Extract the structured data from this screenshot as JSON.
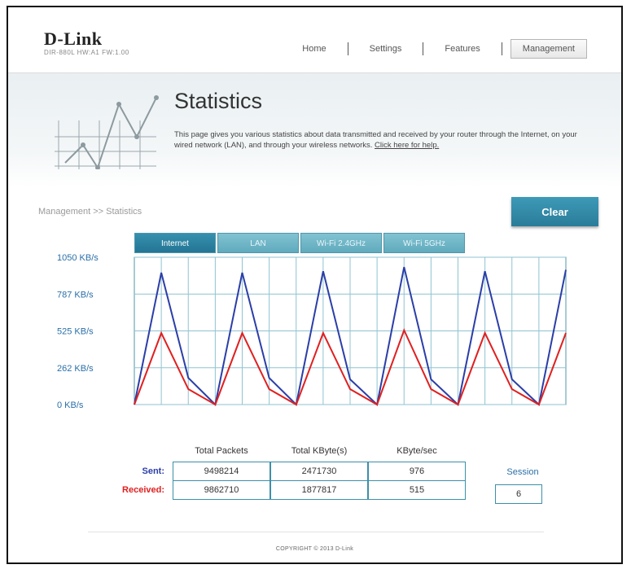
{
  "brand": {
    "logo": "D-Link",
    "model": "DIR-880L   HW:A1   FW:1.00"
  },
  "nav": {
    "items": [
      "Home",
      "Settings",
      "Features",
      "Management"
    ],
    "active": "Management"
  },
  "page": {
    "title": "Statistics",
    "description": "This page gives you various statistics about data transmitted and received by your router through the Internet, on your wired network (LAN), and through your wireless networks. ",
    "help_link": "Click here for help."
  },
  "breadcrumb": "Management >> Statistics",
  "clear_button": "Clear",
  "tabs": [
    {
      "label": "Internet",
      "active": true
    },
    {
      "label": "LAN",
      "active": false
    },
    {
      "label": "Wi-Fi 2.4GHz",
      "active": false
    },
    {
      "label": "Wi-Fi 5GHz",
      "active": false
    }
  ],
  "chart_data": {
    "type": "line",
    "ylim": [
      0,
      1050
    ],
    "yticks": [
      "1050 KB/s",
      "787 KB/s",
      "525 KB/s",
      "262 KB/s",
      "0 KB/s"
    ],
    "grid": true,
    "series": [
      {
        "color": "#2b3ea8",
        "values": [
          0,
          940,
          190,
          0,
          940,
          190,
          0,
          950,
          180,
          0,
          980,
          180,
          0,
          950,
          180,
          0,
          960
        ]
      },
      {
        "color": "#e02020",
        "values": [
          0,
          510,
          110,
          0,
          510,
          110,
          0,
          510,
          110,
          0,
          530,
          110,
          0,
          510,
          110,
          0,
          510
        ]
      }
    ]
  },
  "stats": {
    "headers": [
      "Total Packets",
      "Total KByte(s)",
      "KByte/sec"
    ],
    "rows": [
      {
        "label": "Sent:",
        "color": "#2b3ea8",
        "values": [
          "9498214",
          "2471730",
          "976"
        ]
      },
      {
        "label": "Received:",
        "color": "#e02020",
        "values": [
          "9862710",
          "1877817",
          "515"
        ]
      }
    ],
    "session_label": "Session",
    "session_value": "6"
  },
  "footer": "COPYRIGHT © 2013 D-Link"
}
